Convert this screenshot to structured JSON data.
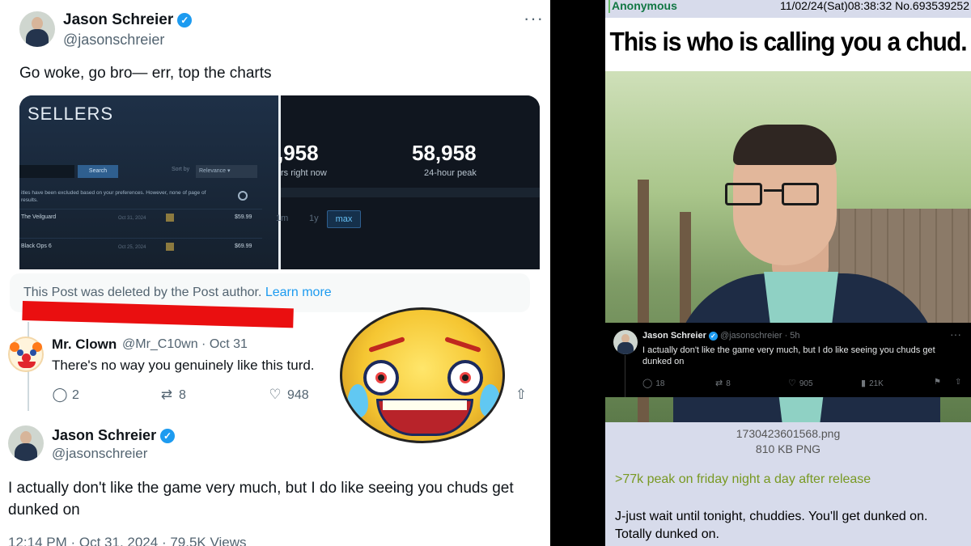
{
  "tweet1": {
    "name": "Jason Schreier",
    "handle": "@jasonschreier",
    "text": "Go woke, go bro— err, top the charts",
    "media": {
      "left_title": "SELLERS",
      "search_button": "Search",
      "sort_by": "Sort by",
      "sort_value": "Relevance",
      "note": "itles have been excluded based on your preferences. However, none of page of results.",
      "rows": [
        {
          "title": "The Veilguard",
          "date": "Oct 31, 2024",
          "price": "$59.99"
        },
        {
          "title": "Black Ops 6",
          "date": "Oct 25, 2024",
          "price": "$69.99"
        }
      ],
      "players_now_value": ",958",
      "players_now_label": "rs right now",
      "peak_value": "58,958",
      "peak_label": "24-hour peak",
      "range_1m": "1m",
      "range_1y": "1y",
      "range_max": "max"
    },
    "deleted_notice": "This Post was deleted by the Post author.",
    "learn_more": "Learn more"
  },
  "reply": {
    "name": "Mr. Clown",
    "handle": "@Mr_C10wn · Oct 31",
    "text": "There's no way you genuinely like this turd.",
    "replies": "2",
    "reposts": "8",
    "likes": "948"
  },
  "tweet2": {
    "name": "Jason Schreier",
    "handle": "@jasonschreier",
    "text": "I actually don't like the game very much, but I do like seeing you chuds get dunked on",
    "footer": "12:14 PM · Oct 31, 2024 · 79.5K Views"
  },
  "post": {
    "name": "Anonymous",
    "meta": "11/02/24(Sat)08:38:32 No.693539252",
    "caption": "This is who is calling you a chud.",
    "embed": {
      "name": "Jason Schreier",
      "handle": "@jasonschreier · 5h",
      "text": "I actually don't like the game very much, but I do like seeing you chuds get dunked on",
      "replies": "18",
      "reposts": "8",
      "likes": "905",
      "views": "21K"
    },
    "file_name": "1730423601568.png",
    "file_size": "810 KB PNG",
    "greentext": ">77k peak on friday night a day after release",
    "body": "J-just wait until tonight, chuddies. You'll get dunked on. Totally dunked on."
  },
  "colors": {
    "x_blue": "#1d9bf0",
    "deleted_bar": "#ea0f10",
    "board_bg": "#d7dbeb",
    "name_green": "#117743",
    "greentext": "#789922"
  }
}
